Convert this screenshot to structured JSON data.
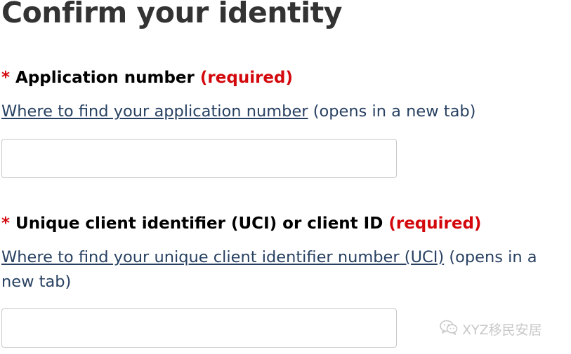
{
  "page": {
    "title": "Confirm your identity"
  },
  "fields": [
    {
      "asterisk": "*",
      "label": "Application number",
      "required": "(required)",
      "help_link": "Where to find your application number",
      "help_suffix": "(opens in a new tab)",
      "value": ""
    },
    {
      "asterisk": "*",
      "label": "Unique client identifier (UCI) or client ID",
      "required": "(required)",
      "help_link": "Where to find your unique client identifier number (UCI)",
      "help_suffix": "(opens in a new tab)",
      "value": ""
    }
  ],
  "watermark": {
    "icon": "wechat-icon",
    "text": "XYZ移民安居"
  }
}
